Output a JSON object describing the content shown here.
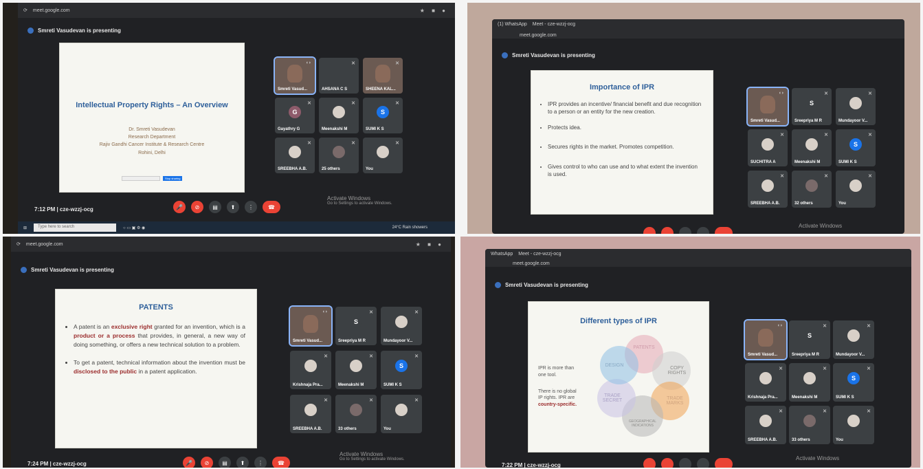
{
  "photo1": {
    "url": "meet.google.com",
    "presenting": "Smreti Vasudevan is presenting",
    "slide": {
      "title": "Intellectual Property Rights – An Overview",
      "author": "Dr. Smreti Vasudevan",
      "dept": "Research Department",
      "institute": "Rajiv Gandhi Cancer Institute & Research Centre",
      "place": "Rohini, Delhi",
      "stop_btn": "Stop sharing"
    },
    "participants": [
      {
        "name": "Smreti Vasud...",
        "type": "video"
      },
      {
        "name": "AHSANA C S",
        "type": "blank"
      },
      {
        "name": "SHEENA KAL...",
        "type": "video"
      },
      {
        "name": "Gayathry G",
        "initial": "G",
        "color": "#8e5b6b"
      },
      {
        "name": "Meenakshi M",
        "type": "image"
      },
      {
        "name": "SUMI K S",
        "initial": "S",
        "color": "#1a73e8"
      },
      {
        "name": "SREEBHA A.B.",
        "type": "image"
      },
      {
        "name": "25 others",
        "type": "group"
      },
      {
        "name": "You",
        "type": "image"
      }
    ],
    "time": "7:12 PM",
    "code": "cze-wzzj-ocg",
    "activate": "Activate Windows",
    "activate_sub": "Go to Settings to activate Windows.",
    "taskbar_search": "Type here to search",
    "weather": "24°C Rain showers"
  },
  "photo2": {
    "tab1": "(1) WhatsApp",
    "tab2": "Meet - cze-wzzj-ocg",
    "url": "meet.google.com",
    "presenting": "Smreti Vasudevan is presenting",
    "slide": {
      "title": "Importance of IPR",
      "bullets": [
        "IPR provides an incentive/ financial benefit and due recognition to a person or an entity for the new creation.",
        "Protects idea.",
        "Secures rights in the market. Promotes competition.",
        "Gives control to who can use and to what extent the invention is used."
      ]
    },
    "participants": [
      {
        "name": "Smreti Vasud...",
        "type": "video"
      },
      {
        "name": "Sreepriya M R",
        "initial": "S",
        "color": "#3c4043"
      },
      {
        "name": "Mundayoor V...",
        "type": "image"
      },
      {
        "name": "SUCHITRA A",
        "type": "image"
      },
      {
        "name": "Meenakshi M",
        "type": "image"
      },
      {
        "name": "SUMI K S",
        "initial": "S",
        "color": "#1a73e8"
      },
      {
        "name": "SREEBHA A.B.",
        "type": "image"
      },
      {
        "name": "32 others",
        "type": "group"
      },
      {
        "name": "You",
        "type": "image"
      }
    ],
    "activate": "Activate Windows"
  },
  "photo3": {
    "url": "meet.google.com",
    "presenting": "Smreti Vasudevan is presenting",
    "slide": {
      "title": "PATENTS",
      "b1_pre": "A patent is an ",
      "b1_hl1": "exclusive right",
      "b1_mid": " granted for an invention, which is a ",
      "b1_hl2": "product or a process",
      "b1_post": " that provides, in general, a new way of doing something, or offers a new technical solution to a problem.",
      "b2_pre": "To get a patent, technical information about the invention must be ",
      "b2_hl": "disclosed to the public",
      "b2_post": " in a patent application."
    },
    "participants": [
      {
        "name": "Smreti Vasud...",
        "type": "video"
      },
      {
        "name": "Sreepriya M R",
        "initial": "S",
        "color": "#3c4043"
      },
      {
        "name": "Mundayoor V...",
        "type": "image"
      },
      {
        "name": "Krishnaja Pra...",
        "type": "image"
      },
      {
        "name": "Meenakshi M",
        "type": "image"
      },
      {
        "name": "SUMI K S",
        "initial": "S",
        "color": "#1a73e8"
      },
      {
        "name": "SREEBHA A.B.",
        "type": "image"
      },
      {
        "name": "33 others",
        "type": "group"
      },
      {
        "name": "You",
        "type": "image"
      }
    ],
    "time": "7:24 PM",
    "code": "cze-wzzj-ocg",
    "activate": "Activate Windows",
    "activate_sub": "Go to Settings to activate Windows."
  },
  "photo4": {
    "tab1": "WhatsApp",
    "tab2": "Meet - cze-wzzj-ocg",
    "url": "meet.google.com",
    "presenting": "Smreti Vasudevan is presenting",
    "slide": {
      "title": "Different types of IPR",
      "note1": "IPR is more than one tool.",
      "note2_pre": "There is no global IP rights. IPR are ",
      "note2_hl": "country-specific.",
      "circles": {
        "patents": "PATENTS",
        "copy": "COPY RIGHTS",
        "trade_marks": "TRADE MARKS",
        "geo": "GEOGRAPHICAL INDICATIONS",
        "trade_secret": "TRADE SECRET",
        "design": "DESIGN"
      }
    },
    "participants": [
      {
        "name": "Smreti Vasud...",
        "type": "video"
      },
      {
        "name": "Sreepriya M R",
        "initial": "S",
        "color": "#3c4043"
      },
      {
        "name": "Mundayoor V...",
        "type": "image"
      },
      {
        "name": "Krishnaja Pra...",
        "type": "image"
      },
      {
        "name": "Meenakshi M",
        "type": "image"
      },
      {
        "name": "SUMI K S",
        "initial": "S",
        "color": "#1a73e8"
      },
      {
        "name": "SREEBHA A.B.",
        "type": "image"
      },
      {
        "name": "33 others",
        "type": "group"
      },
      {
        "name": "You",
        "type": "image"
      }
    ],
    "time": "7:22 PM",
    "code": "cze-wzzj-ocg",
    "activate": "Activate Windows"
  }
}
